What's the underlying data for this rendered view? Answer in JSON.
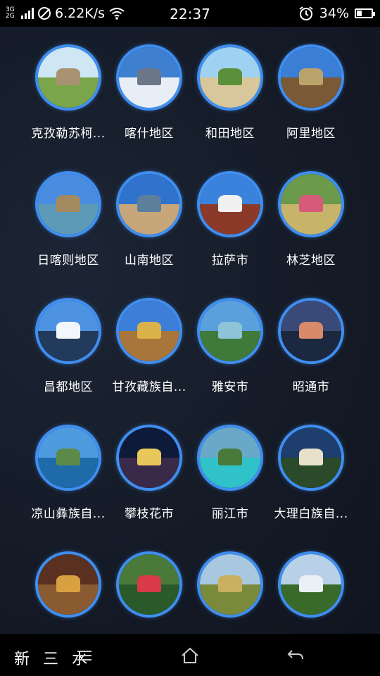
{
  "status_bar": {
    "network_type": "3G 2G",
    "speed": "6.22K/s",
    "time": "22:37",
    "battery": "34%",
    "battery_level": 0.34,
    "icons": [
      "signal-icon",
      "no-disturb-icon",
      "wifi-icon",
      "alarm-icon",
      "battery-icon"
    ]
  },
  "regions": [
    {
      "label": "克孜勒苏柯...",
      "colors": {
        "sky": "#cfe6f5",
        "ground": "#7aa54a",
        "accent": "#a89272"
      }
    },
    {
      "label": "喀什地区",
      "colors": {
        "sky": "#3f7fd0",
        "ground": "#e8eef5",
        "accent": "#6b7686"
      }
    },
    {
      "label": "和田地区",
      "colors": {
        "sky": "#9fd2f0",
        "ground": "#d7c79a",
        "accent": "#5b8f3a"
      }
    },
    {
      "label": "阿里地区",
      "colors": {
        "sky": "#3a7ed6",
        "ground": "#7a5a36",
        "accent": "#b9a36a"
      }
    },
    {
      "label": "日喀则地区",
      "colors": {
        "sky": "#4a8de0",
        "ground": "#5d9ab8",
        "accent": "#a48a5f"
      }
    },
    {
      "label": "山南地区",
      "colors": {
        "sky": "#2f73cc",
        "ground": "#c7a77a",
        "accent": "#5c7f9c"
      }
    },
    {
      "label": "拉萨市",
      "colors": {
        "sky": "#3b82dc",
        "ground": "#8b3a2a",
        "accent": "#f0f0f0"
      }
    },
    {
      "label": "林芝地区",
      "colors": {
        "sky": "#6a9a4a",
        "ground": "#c7b36a",
        "accent": "#d65a7a"
      }
    },
    {
      "label": "昌都地区",
      "colors": {
        "sky": "#4d93e2",
        "ground": "#223a5c",
        "accent": "#f3f6fa"
      }
    },
    {
      "label": "甘孜藏族自...",
      "colors": {
        "sky": "#3d7ed8",
        "ground": "#a8763a",
        "accent": "#d9b34a"
      }
    },
    {
      "label": "雅安市",
      "colors": {
        "sky": "#5aa0dc",
        "ground": "#3f7a3a",
        "accent": "#8ec3d8"
      }
    },
    {
      "label": "昭通市",
      "colors": {
        "sky": "#3a4a78",
        "ground": "#1c2840",
        "accent": "#d98a6a"
      }
    },
    {
      "label": "凉山彝族自...",
      "colors": {
        "sky": "#4f9be0",
        "ground": "#1f6aa8",
        "accent": "#5c8a4a"
      }
    },
    {
      "label": "攀枝花市",
      "colors": {
        "sky": "#0d1a3a",
        "ground": "#3a2a4a",
        "accent": "#e8c85a"
      }
    },
    {
      "label": "丽江市",
      "colors": {
        "sky": "#6aa8c8",
        "ground": "#2fc2c8",
        "accent": "#4a7a3a"
      }
    },
    {
      "label": "大理白族自...",
      "colors": {
        "sky": "#1e3e6e",
        "ground": "#2a4a2a",
        "accent": "#e8e0c8"
      }
    },
    {
      "label": "",
      "colors": {
        "sky": "#5a3020",
        "ground": "#8a5a30",
        "accent": "#d8a040"
      }
    },
    {
      "label": "",
      "colors": {
        "sky": "#4a7a3a",
        "ground": "#2a5a2a",
        "accent": "#d83a4a"
      }
    },
    {
      "label": "",
      "colors": {
        "sky": "#a8c8e0",
        "ground": "#7a8a3a",
        "accent": "#c8b060"
      }
    },
    {
      "label": "",
      "colors": {
        "sky": "#b8d0e8",
        "ground": "#3a6a2a",
        "accent": "#eaf0f5"
      }
    }
  ],
  "nav_bar": {
    "watermark": "新 三 水",
    "icons": [
      "menu-icon",
      "home-icon",
      "back-icon"
    ]
  }
}
